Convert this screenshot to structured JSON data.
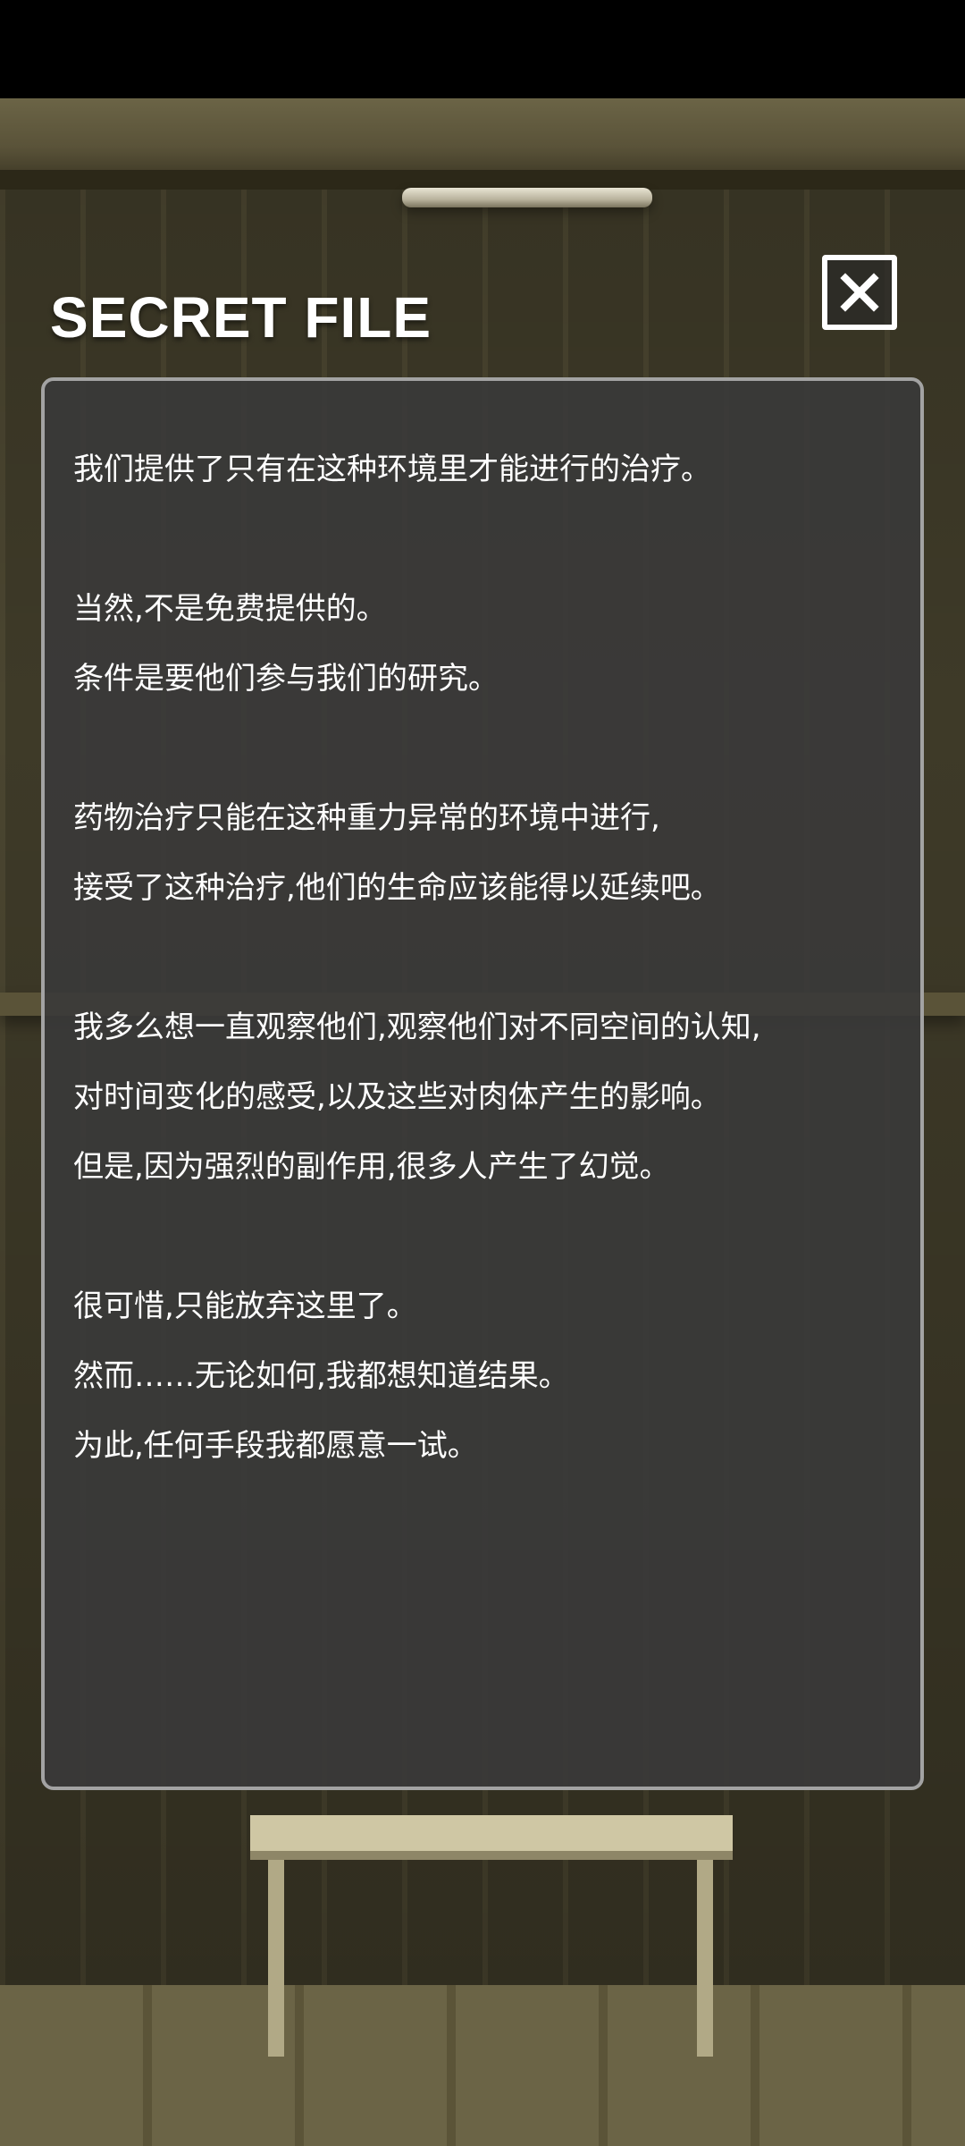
{
  "dialog": {
    "title": "SECRET FILE",
    "close_icon": "close-icon",
    "lines": [
      "我们提供了只有在这种环境里才能进行的治疗。",
      "",
      "当然,不是免费提供的。",
      "条件是要他们参与我们的研究。",
      "",
      "药物治疗只能在这种重力异常的环境中进行,",
      "接受了这种治疗,他们的生命应该能得以延续吧。",
      "",
      "我多么想一直观察他们,观察他们对不同空间的认知,",
      "对时间变化的感受,以及这些对肉体产生的影响。",
      "但是,因为强烈的副作用,很多人产生了幻觉。",
      "",
      "很可惜,只能放弃这里了。",
      "然而……无论如何,我都想知道结果。",
      "为此,任何手段我都愿意一试。"
    ]
  },
  "colors": {
    "panel_bg": "#3a3a3a",
    "panel_border": "#a3a3a3",
    "text": "#ffffff"
  }
}
